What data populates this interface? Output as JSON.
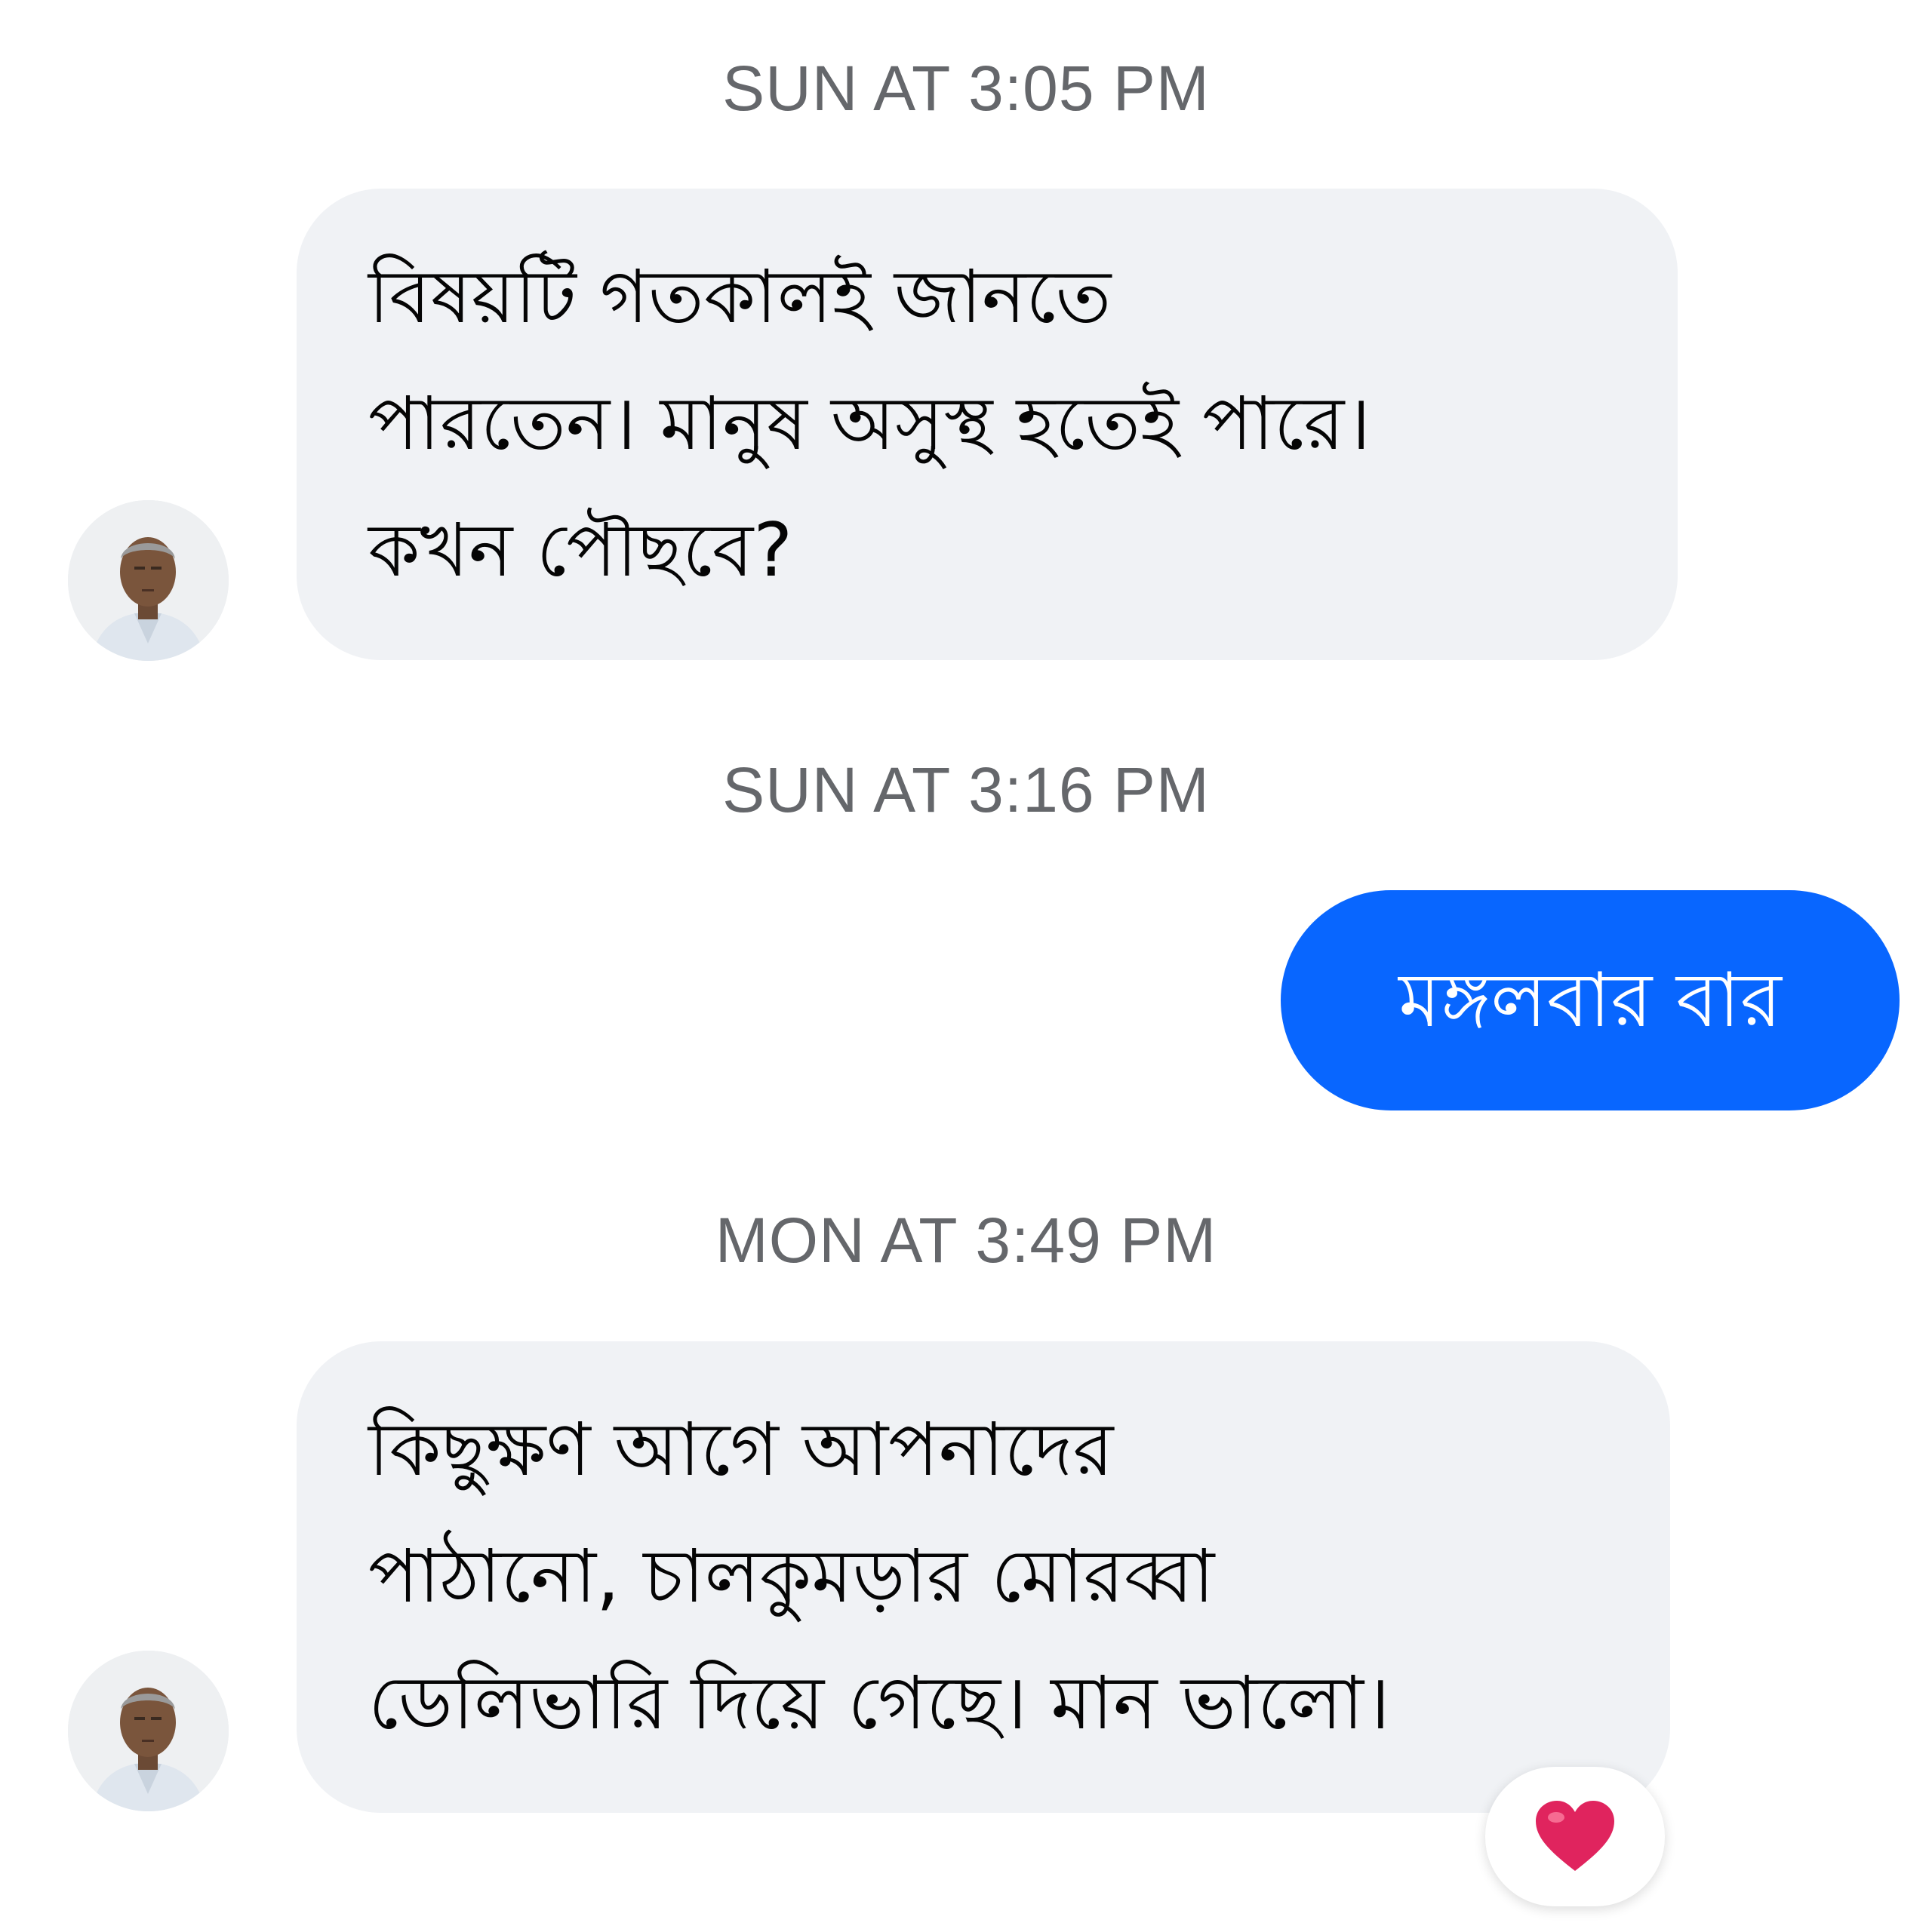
{
  "conversation": {
    "messages": [
      {
        "timestamp": "SUN AT 3:05 PM",
        "direction": "incoming",
        "lines": [
          "বিষয়টি গতকালই জানতে",
          "পারতেন। মানুষ অসুস্থ হতেই পারে।",
          "কখন পৌছবে?"
        ]
      },
      {
        "timestamp": "SUN AT 3:16 PM",
        "direction": "outgoing",
        "text": "মঙ্গলবার বার"
      },
      {
        "timestamp": "MON AT 3:49 PM",
        "direction": "incoming",
        "lines": [
          "কিছুক্ষণ আগে আপনাদের",
          "পাঠানো, চালকুমড়ার মোরব্বা",
          "ডেলিভারি দিয়ে গেছে। মান ভালো।"
        ],
        "reaction": "heart-icon"
      }
    ]
  },
  "colors": {
    "incoming_bubble": "#f0f2f5",
    "outgoing_bubble": "#0866ff",
    "timestamp_text": "#65676b",
    "reaction_heart": "#e0245e"
  },
  "icons": {
    "avatar": "avatar-photo",
    "reaction": "heart-icon"
  }
}
